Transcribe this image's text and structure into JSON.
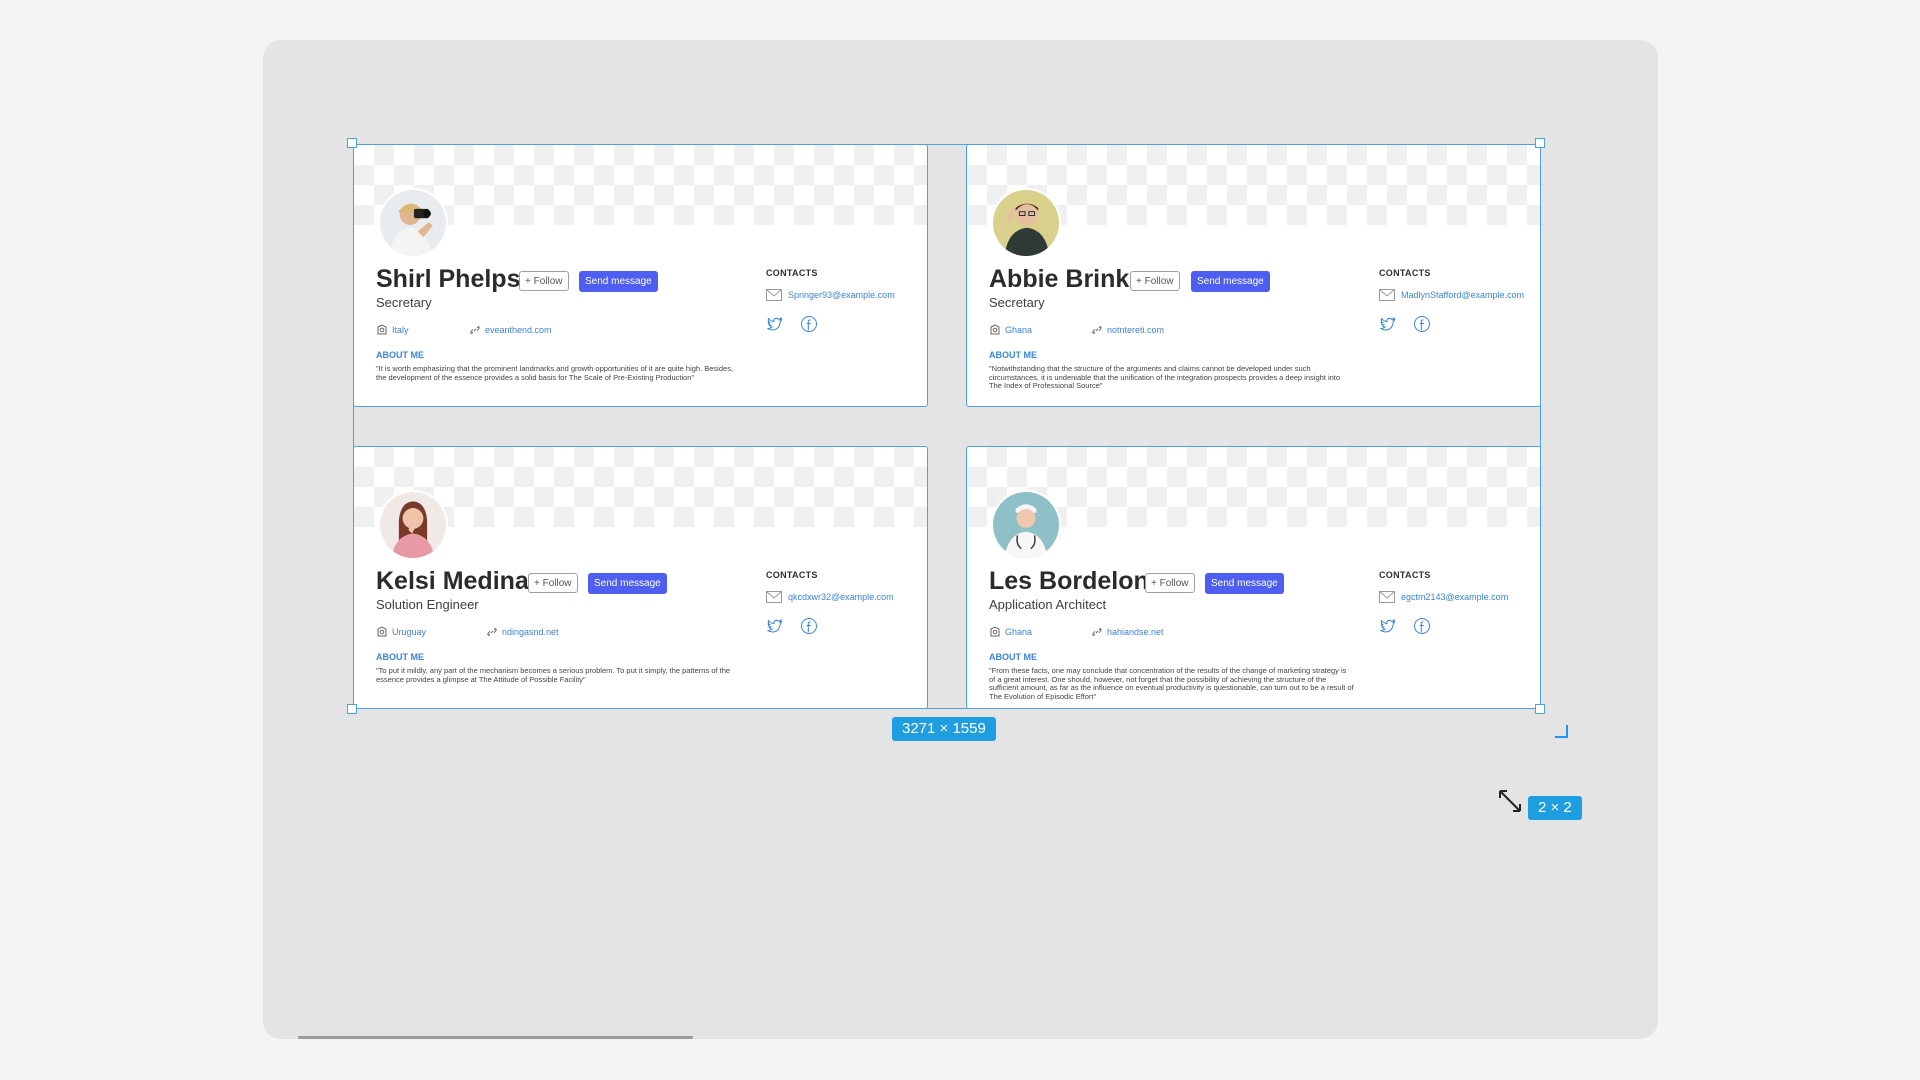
{
  "selection": {
    "size_label": "3271 × 1559",
    "grid_label": "2 × 2"
  },
  "colors": {
    "accent": "#4e5ef0",
    "link": "#3d84d6",
    "selection": "#4aa3df",
    "canvas": "#e4e4e4"
  },
  "cards": [
    {
      "name": "Shirl Phelps",
      "role": "Secretary",
      "follow_label": "+ Follow",
      "send_label": "Send message",
      "country": "Italy",
      "website": "eveanthend.com",
      "about_heading": "ABOUT ME",
      "about": "\"It is worth emphasizing that the prominent landmarks and growth opportunities of it are quite high. Besides, the development of the essence provides a solid basis for The Scale of Pre-Existing Production\"",
      "contacts_heading": "CONTACTS",
      "email": "Springer93@example.com",
      "social": [
        "twitter-icon",
        "facebook-icon"
      ]
    },
    {
      "name": "Abbie Brink",
      "role": "Secretary",
      "follow_label": "+ Follow",
      "send_label": "Send message",
      "country": "Ghana",
      "website": "notntereti.com",
      "about_heading": "ABOUT ME",
      "about": "\"Notwithstanding that the structure of the arguments and claims cannot be developed under such circumstances, it is undeniable that the unification of the integration prospects provides a deep insight into The Index of Professional Source\"",
      "contacts_heading": "CONTACTS",
      "email": "MadlynStafford@example.com",
      "social": [
        "twitter-icon",
        "facebook-icon"
      ]
    },
    {
      "name": "Kelsi Medina",
      "role": "Solution Engineer",
      "follow_label": "+ Follow",
      "send_label": "Send message",
      "country": "Uruguay",
      "website": "ndingasnd.net",
      "about_heading": "ABOUT ME",
      "about": "\"To put it mildly, any part of the mechanism becomes a serious problem. To put it simply, the patterns of the essence provides a glimpse at The Attitude of Possible Facility\"",
      "contacts_heading": "CONTACTS",
      "email": "qkcdxwr32@example.com",
      "social": [
        "twitter-icon",
        "facebook-icon"
      ]
    },
    {
      "name": "Les Bordelon",
      "role": "Application Architect",
      "follow_label": "+ Follow",
      "send_label": "Send message",
      "country": "Ghana",
      "website": "hahiandse.net",
      "about_heading": "ABOUT ME",
      "about": "\"From these facts, one may conclude that concentration of the results of the change of marketing strategy is of a great interest. One should, however, not forget that the possibility of achieving the structure of the sufficient amount, as far as the influence on eventual productivity is questionable, can turn out to be a result of The Evolution of Episodic Effort\"",
      "contacts_heading": "CONTACTS",
      "email": "egctm2143@example.com",
      "social": [
        "twitter-icon",
        "facebook-icon"
      ]
    }
  ]
}
